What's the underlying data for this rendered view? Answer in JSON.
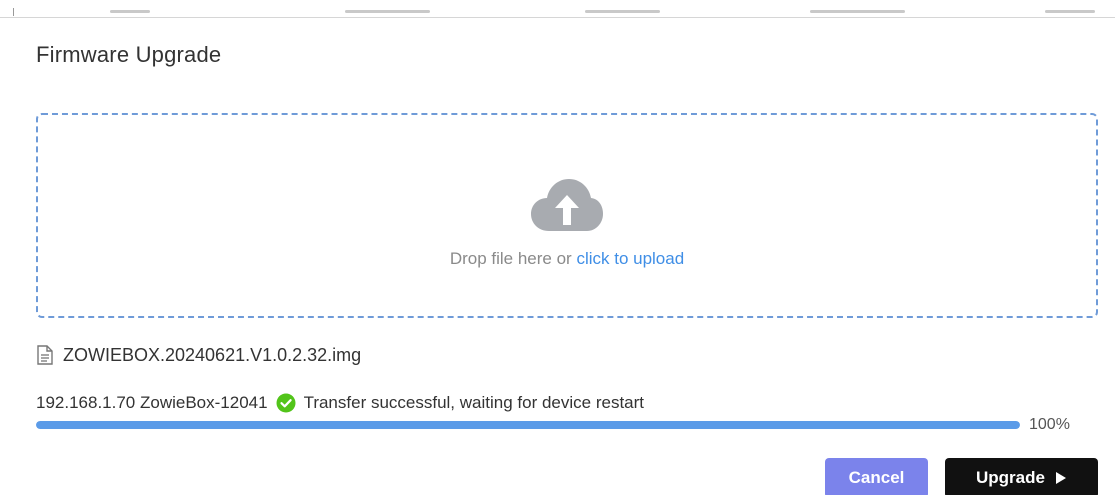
{
  "dialog": {
    "title": "Firmware Upgrade"
  },
  "dropzone": {
    "text": "Drop file here or ",
    "link": "click to upload",
    "icon": "cloud-upload-icon"
  },
  "file": {
    "name": "ZOWIEBOX.20240621.V1.0.2.32.img",
    "icon": "file-document-icon"
  },
  "status": {
    "device": "192.168.1.70 ZowieBox-12041",
    "message": "Transfer successful, waiting for device restart",
    "icon": "check-circle-icon",
    "icon_color": "#52c41a"
  },
  "progress": {
    "value": 1.0,
    "label": "100%",
    "color": "#5b9be8"
  },
  "buttons": {
    "cancel": "Cancel",
    "upgrade": "Upgrade",
    "cancel_color": "#7b83eb",
    "upgrade_color": "#111111"
  }
}
